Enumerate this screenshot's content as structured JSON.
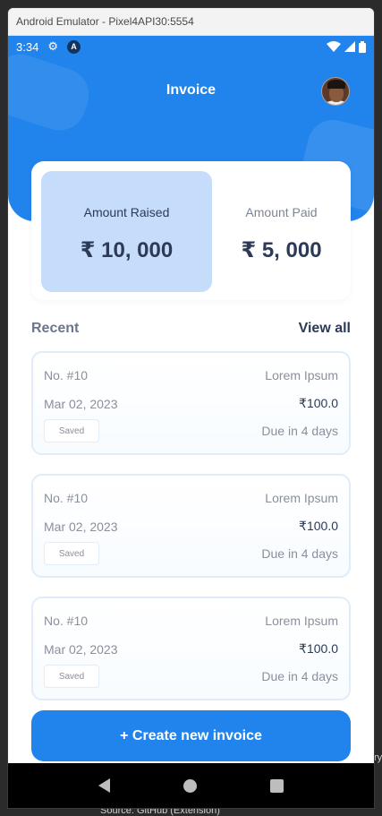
{
  "window": {
    "title": "Android Emulator - Pixel4API30:5554"
  },
  "statusbar": {
    "time": "3:34",
    "badge_letter": "A",
    "settings_icon": "gear-icon"
  },
  "header": {
    "title": "Invoice"
  },
  "summary": {
    "raised_label": "Amount Raised",
    "raised_value": "₹ 10, 000",
    "paid_label": "Amount Paid",
    "paid_value": "₹ 5, 000"
  },
  "recent": {
    "label": "Recent",
    "view_all": "View all",
    "invoices": [
      {
        "number": "No. #10",
        "client": "Lorem Ipsum",
        "date": "Mar 02, 2023",
        "amount": "₹100.0",
        "status": "Saved",
        "due": "Due in 4 days"
      },
      {
        "number": "No. #10",
        "client": "Lorem Ipsum",
        "date": "Mar 02, 2023",
        "amount": "₹100.0",
        "status": "Saved",
        "due": "Due in 4 days"
      },
      {
        "number": "No. #10",
        "client": "Lorem Ipsum",
        "date": "Mar 02, 2023",
        "amount": "₹100.0",
        "status": "Saved",
        "due": "Due in 4 days"
      }
    ]
  },
  "actions": {
    "create_label": "+ Create new invoice"
  },
  "desktop": {
    "footer_text": "Source: GitHub (Extension)",
    "edge_text": "ry"
  },
  "colors": {
    "primary": "#2184ec",
    "raised_bg": "#c5dcfa",
    "text_dark": "#2c3a57"
  }
}
